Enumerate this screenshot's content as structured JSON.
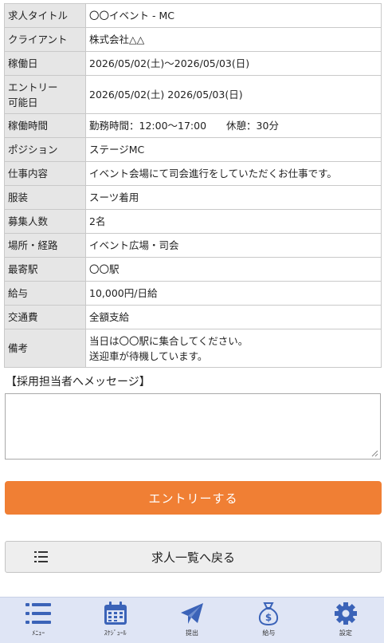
{
  "job_details": [
    {
      "label": "求人タイトル",
      "value": "〇〇イベント - MC"
    },
    {
      "label": "クライアント",
      "value": "株式会社△△"
    },
    {
      "label": "稼働日",
      "value": "2026/05/02(土)〜2026/05/03(日)"
    },
    {
      "label": "エントリー\n可能日",
      "value": "2026/05/02(土)  2026/05/03(日)"
    },
    {
      "label": "稼働時間",
      "value": "勤務時間：12:00〜17:00　　休憩：30分"
    },
    {
      "label": "ポジション",
      "value": "ステージMC"
    },
    {
      "label": "仕事内容",
      "value": "イベント会場にて司会進行をしていただくお仕事です。"
    },
    {
      "label": "服装",
      "value": "スーツ着用"
    },
    {
      "label": "募集人数",
      "value": "2名"
    },
    {
      "label": "場所・経路",
      "value": "イベント広場・司会"
    },
    {
      "label": "最寄駅",
      "value": "〇〇駅"
    },
    {
      "label": "給与",
      "value": "10,000円/日給"
    },
    {
      "label": "交通費",
      "value": "全額支給"
    },
    {
      "label": "備考",
      "value": "当日は〇〇駅に集合してください。\n送迎車が待機しています。"
    }
  ],
  "message": {
    "label": "【採用担当者へメッセージ】",
    "value": ""
  },
  "entry_button": "エントリーする",
  "back_button": "求人一覧へ戻る",
  "nav": [
    {
      "label": "ﾒﾆｭｰ",
      "icon": "menu-icon"
    },
    {
      "label": "ｽｹｼﾞｭｰﾙ",
      "icon": "calendar-icon"
    },
    {
      "label": "提出",
      "icon": "send-icon"
    },
    {
      "label": "給与",
      "icon": "money-bag-icon"
    },
    {
      "label": "設定",
      "icon": "gear-icon"
    }
  ],
  "colors": {
    "accent": "#f07f34",
    "nav_icon": "#3b63b8",
    "nav_bg": "#dfe5f5",
    "label_bg": "#e6e6e6"
  }
}
